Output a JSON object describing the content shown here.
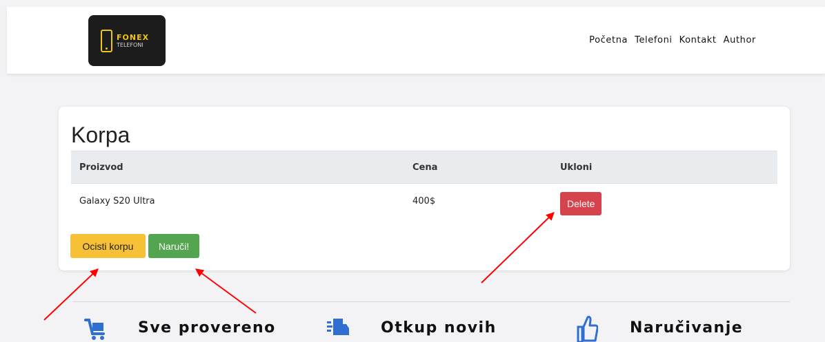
{
  "header": {
    "logo_brand": "FONEX",
    "logo_sub": "TELEFONI",
    "nav": [
      "Početna",
      "Telefoni",
      "Kontakt",
      "Author"
    ]
  },
  "cart": {
    "title": "Korpa",
    "columns": [
      "Proizvod",
      "Cena",
      "Ukloni"
    ],
    "rows": [
      {
        "product": "Galaxy S20 Ultra",
        "price": "400$",
        "action_label": "Delete"
      }
    ],
    "clear_label": "Ocisti korpu",
    "order_label": "Naruči!"
  },
  "features": [
    {
      "icon": "cart-icon",
      "title": "Sve provereno"
    },
    {
      "icon": "truck-icon",
      "title": "Otkup novih"
    },
    {
      "icon": "thumbs-up-icon",
      "title": "Naručivanje"
    }
  ],
  "colors": {
    "accent_yellow": "#f7c137",
    "accent_green": "#54a54f",
    "danger_red": "#d7434d",
    "icon_blue": "#2f6fd1",
    "annotation_red": "#ff0000"
  }
}
